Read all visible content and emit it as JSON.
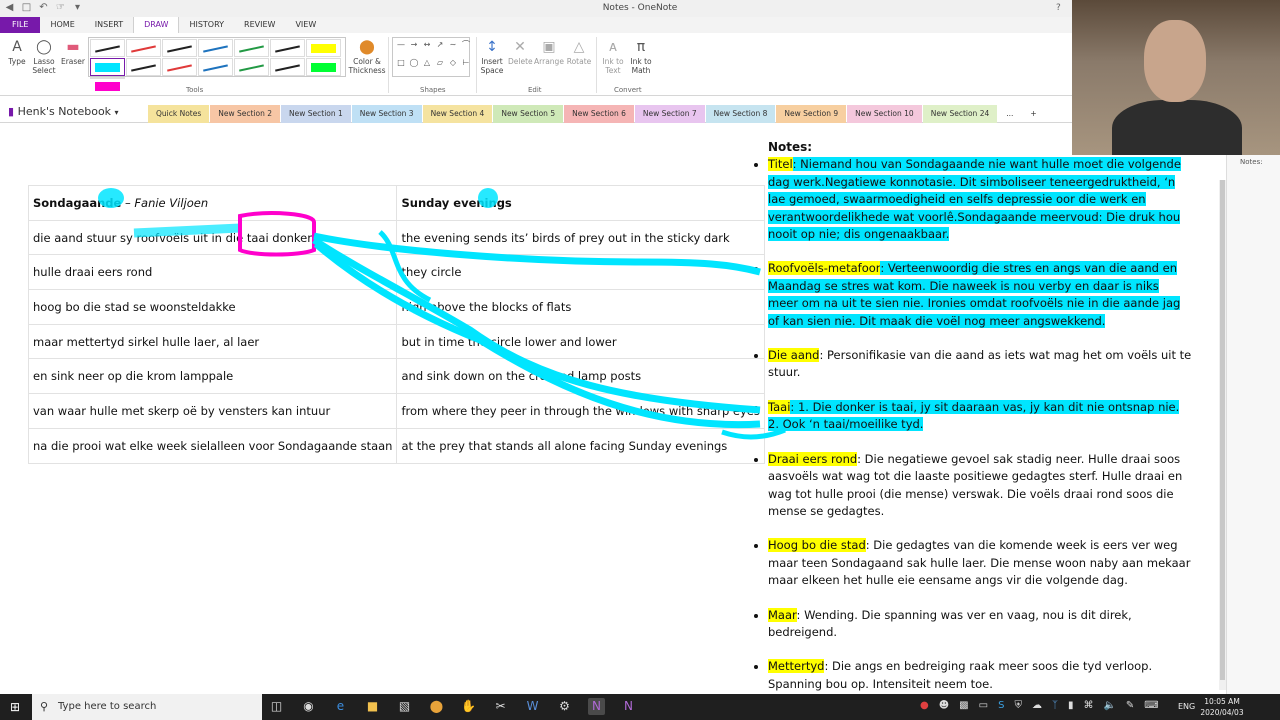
{
  "window": {
    "title": "Notes - OneNote",
    "help": "?"
  },
  "ribbon_tabs": [
    "FILE",
    "HOME",
    "INSERT",
    "DRAW",
    "HISTORY",
    "REVIEW",
    "VIEW"
  ],
  "ribbon": {
    "type": "Type",
    "lasso": "Lasso Select",
    "eraser": "Eraser",
    "color_thickness": "Color & Thickness",
    "insert_space": "Insert Space",
    "delete": "Delete",
    "arrange": "Arrange",
    "rotate": "Rotate",
    "ink_to_text": "Ink to Text",
    "ink_to_math": "Ink to Math",
    "groups": {
      "tools": "Tools",
      "shapes": "Shapes",
      "edit": "Edit",
      "convert": "Convert"
    },
    "pen_colors": [
      "#222222",
      "#e03a3a",
      "#222222",
      "#1e73be",
      "#229944",
      "#222222",
      "#ffff00",
      "#00e5ff",
      "#222222",
      "#e03a3a",
      "#1e73be",
      "#229944",
      "#222222",
      "#00ff33",
      "#ff00cc"
    ]
  },
  "notebook": {
    "name": "Henk's Notebook",
    "sections": [
      {
        "label": "Quick Notes",
        "color": "#f5e39c"
      },
      {
        "label": "New Section 2",
        "color": "#f7c6a5"
      },
      {
        "label": "New Section 1",
        "color": "#c9d7ee"
      },
      {
        "label": "New Section 3",
        "color": "#bfe0f5"
      },
      {
        "label": "New Section 4",
        "color": "#f5e3a0"
      },
      {
        "label": "New Section 5",
        "color": "#cfe9b8"
      },
      {
        "label": "New Section 6",
        "color": "#f5b5b5"
      },
      {
        "label": "New Section 7",
        "color": "#e8c5ef"
      },
      {
        "label": "New Section 8",
        "color": "#c6e4f0"
      },
      {
        "label": "New Section 9",
        "color": "#f7cfa0"
      },
      {
        "label": "New Section 10",
        "color": "#f4c8dc"
      },
      {
        "label": "New Section 24",
        "color": "#dff0c8"
      }
    ],
    "more": "...",
    "add": "+"
  },
  "sidepane": {
    "label": "Notes:"
  },
  "poem": {
    "title_af": "Sondagaande",
    "dash": " – ",
    "author": "Fanie Viljoen",
    "title_en": "Sunday evenings",
    "lines_af": [
      "die aand stuur sy roofvoëls uit in die taai donker",
      "hulle draai eers rond",
      "hoog bo die stad se woonsteldakke",
      "maar mettertyd sirkel hulle laer, al laer",
      "en sink neer op die krom lamppale",
      "van waar hulle met skerp oë by vensters kan intuur",
      "na die prooi wat elke week sielalleen voor Sondagaande staan"
    ],
    "lines_en": [
      "the evening sends its’ birds of prey out in the sticky dark",
      "they circle",
      "high above the blocks of flats",
      "but in time the circle lower and lower",
      "and sink down on the crooked lamp posts",
      "from where they peer in through the windows with sharp eyes",
      "at the prey that stands all alone facing Sunday evenings"
    ]
  },
  "notes": {
    "heading": "Notes:",
    "items": [
      {
        "key": "Titel",
        "text": ": Niemand hou van Sondagaande nie want hulle moet die volgende dag werk.Negatiewe konnotasie. Dit simboliseer teneergedruktheid, ‘n lae gemoed, swaarmoedigheid en selfs depressie oor die werk en verantwoordelikhede wat voorlê.Sondagaande meervoud: Die druk hou nooit op nie; dis ongenaakbaar."
      },
      {
        "key": "Roofvoëls-metafoor",
        "text": ": Verteenwoordig die stres en angs van die aand en Maandag se stres wat kom. Die naweek is nou verby en daar is niks meer om na uit te sien nie. Ironies omdat roofvoëls nie in die aande jag of kan sien nie. Dit maak die voël nog meer angswekkend."
      },
      {
        "key": "Die aand",
        "text": ": Personifikasie van die aand as iets wat mag het om voëls uit te stuur."
      },
      {
        "key": "Taai",
        "text": ": 1. Die donker is taai, jy sit daaraan vas, jy kan dit nie ontsnap nie. 2. Ook ‘n taai/moeilike tyd."
      },
      {
        "key": "Draai eers rond",
        "text": ": Die negatiewe gevoel sak stadig neer. Hulle draai soos aasvoëls wat wag tot die laaste positiewe gedagtes sterf. Hulle draai en wag tot hulle prooi (die mense) verswak. Die voëls draai rond soos die mense se gedagtes."
      },
      {
        "key": "Hoog bo die stad",
        "text": ": Die gedagtes van die komende week is eers ver weg maar teen Sondagaand sak hulle laer. Die mense woon naby aan mekaar maar elkeen het hulle eie eensame angs vir die volgende dag."
      },
      {
        "key": "Maar",
        "text": ": Wending. Die spanning was ver en vaag, nou is dit direk, bedreigend."
      },
      {
        "key": "Mettertyd",
        "text": ": Die angs en bedreiging raak meer soos die tyd verloop. Spanning bou op. Intensiteit neem toe."
      }
    ]
  },
  "taskbar": {
    "search_placeholder": "Type here to search",
    "lang": "ENG",
    "time": "10:05 AM",
    "date": "2020/04/03"
  }
}
